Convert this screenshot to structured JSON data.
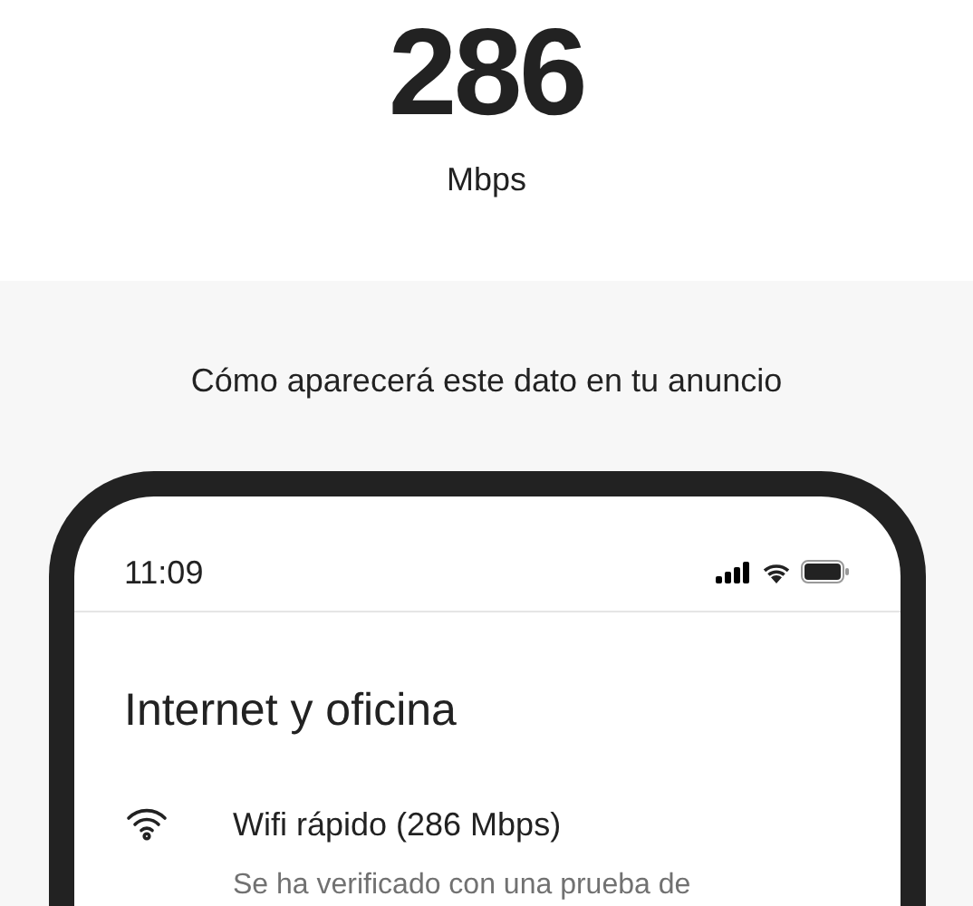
{
  "speed": {
    "value": "286",
    "unit": "Mbps"
  },
  "caption": "Cómo aparecerá este dato en tu anuncio",
  "phone": {
    "time": "11:09",
    "section_title": "Internet y oficina",
    "amenity": {
      "title": "Wifi rápido (286 Mbps)",
      "description": "Se ha verificado con una prueba de"
    }
  }
}
